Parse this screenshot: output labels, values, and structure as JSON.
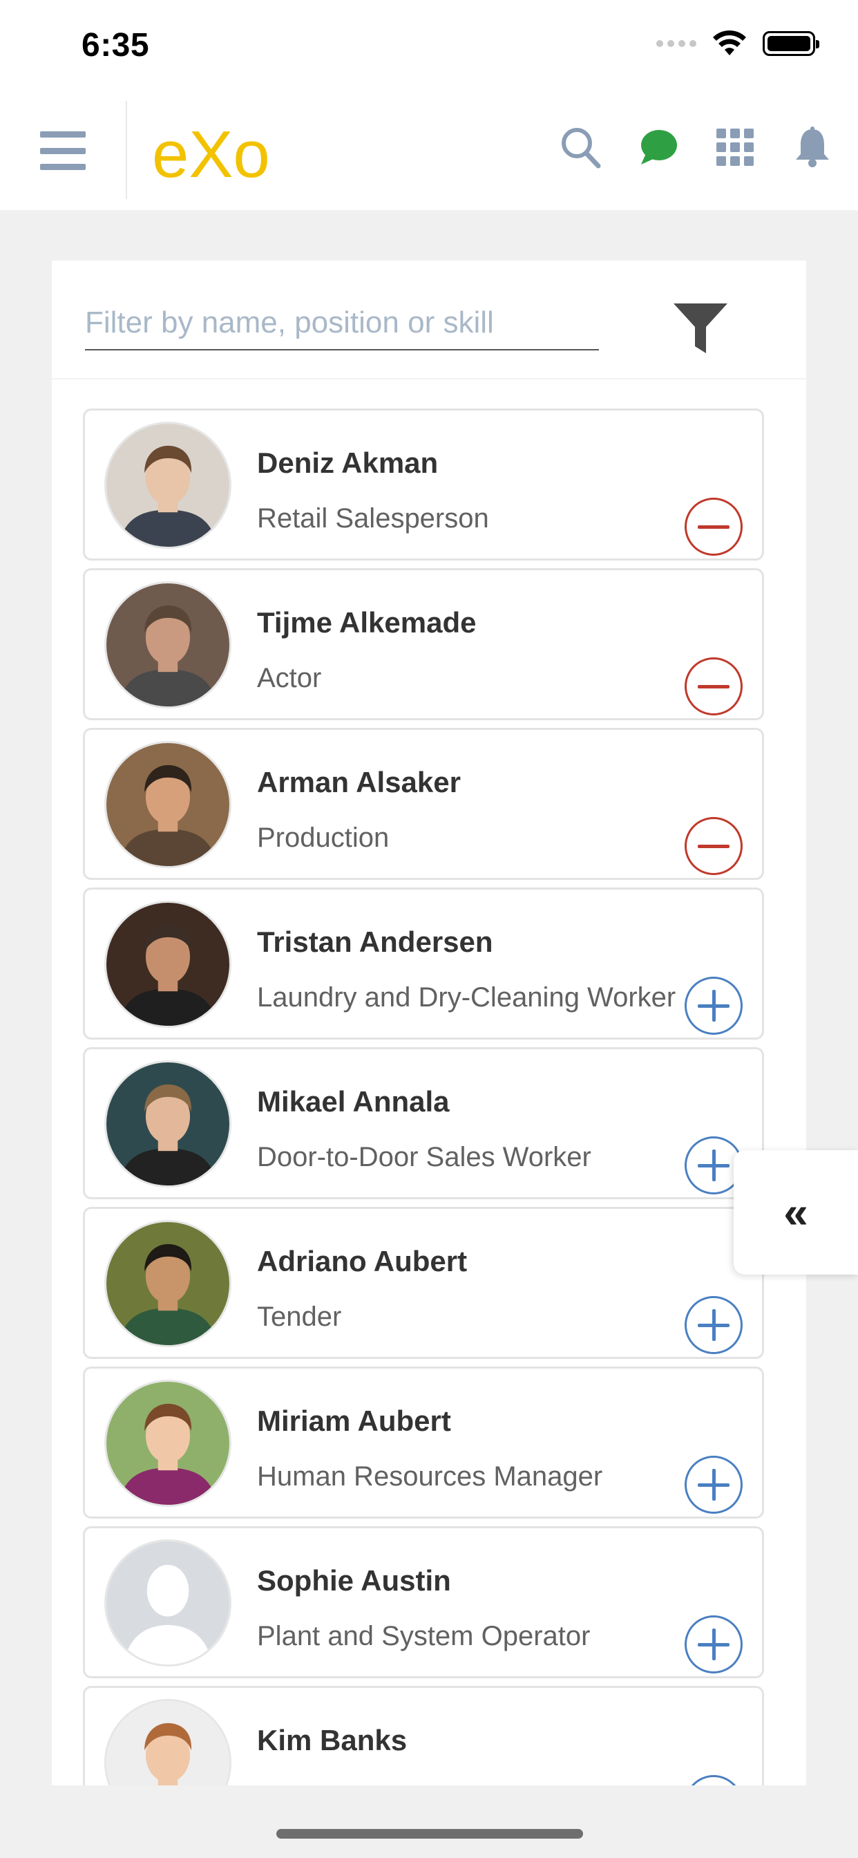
{
  "status": {
    "time": "6:35"
  },
  "header": {
    "logo_text": "eXo",
    "icons": [
      "hamburger-menu-icon",
      "search-icon",
      "chat-icon",
      "apps-grid-icon",
      "notification-bell-icon"
    ],
    "colors": {
      "menu": "#8a9db5",
      "logo": "#f2c200",
      "chat": "#2ea043",
      "icons": "#8a9db5"
    }
  },
  "filter": {
    "placeholder": "Filter by name, position or skill",
    "value": ""
  },
  "people": [
    {
      "name": "Deniz Akman",
      "position": "Retail Salesperson",
      "action": "remove"
    },
    {
      "name": "Tijme Alkemade",
      "position": "Actor",
      "action": "remove"
    },
    {
      "name": "Arman Alsaker",
      "position": "Production",
      "action": "remove"
    },
    {
      "name": "Tristan Andersen",
      "position": "Laundry and Dry-Cleaning Worker",
      "action": "add"
    },
    {
      "name": "Mikael Annala",
      "position": "Door-to-Door Sales Worker",
      "action": "add"
    },
    {
      "name": "Adriano Aubert",
      "position": "Tender",
      "action": "add"
    },
    {
      "name": "Miriam Aubert",
      "position": "Human Resources Manager",
      "action": "add"
    },
    {
      "name": "Sophie Austin",
      "position": "Plant and System Operator",
      "action": "add"
    },
    {
      "name": "Kim Banks",
      "position": "",
      "action": "add"
    }
  ],
  "drawer_toggle": {
    "label": "«"
  },
  "colors": {
    "remove": "#c0392b",
    "add": "#4a7fc1"
  }
}
